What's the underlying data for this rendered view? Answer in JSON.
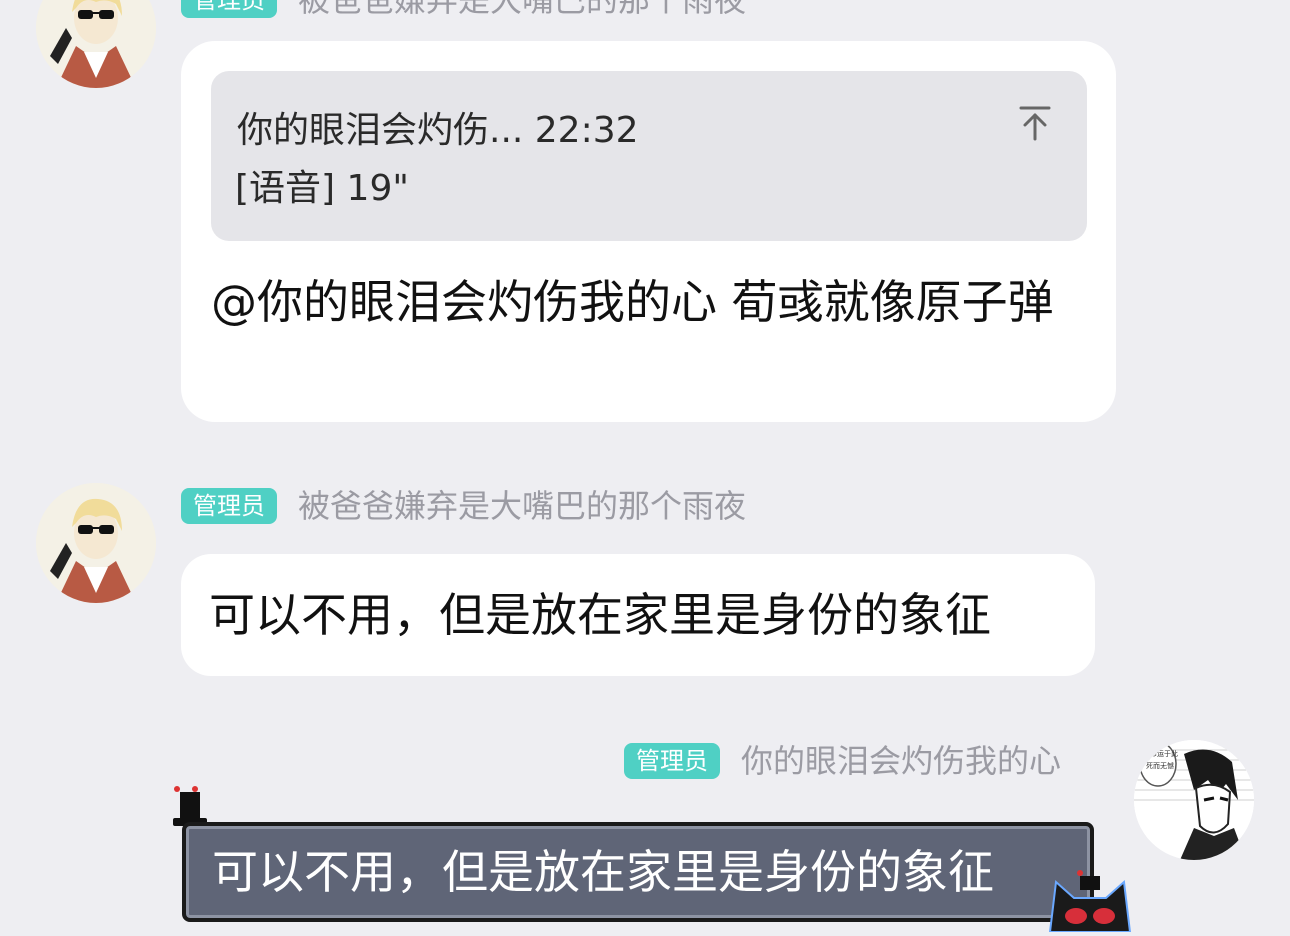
{
  "messages": [
    {
      "badge": "管理员",
      "nickname": "被爸爸嫌弃是大嘴巴的那个雨夜",
      "quote": {
        "title": "你的眼泪会灼伤... 22:32",
        "body": "[语音] 19\""
      },
      "text": "@你的眼泪会灼伤我的心 荀彧就像原子弹"
    },
    {
      "badge": "管理员",
      "nickname": "被爸爸嫌弃是大嘴巴的那个雨夜",
      "text": "可以不用，但是放在家里是身份的象征"
    },
    {
      "badge": "管理员",
      "nickname": "你的眼泪会灼伤我的心",
      "text": "可以不用，但是放在家里是身份的象征"
    }
  ],
  "avatar_manga": {
    "bubble_text": "命运于此\n死而无憾！"
  },
  "colors": {
    "background": "#eeeef2",
    "badge": "#4fd0c4",
    "nickname": "#9b9ba3",
    "dark_bubble": "#5f6577"
  }
}
